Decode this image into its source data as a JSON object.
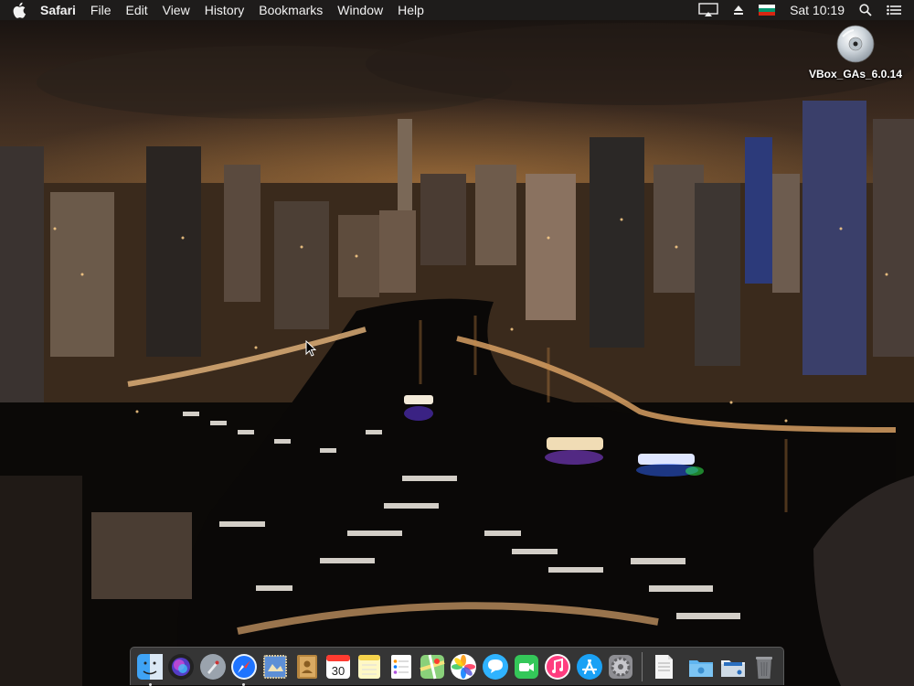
{
  "menubar": {
    "app_name": "Safari",
    "menus": [
      "File",
      "Edit",
      "View",
      "History",
      "Bookmarks",
      "Window",
      "Help"
    ],
    "clock": "Sat 10:19",
    "status_icons": [
      "airplay-icon",
      "eject-icon",
      "flag-bulgaria-icon",
      "spotlight-icon",
      "notification-center-icon"
    ]
  },
  "desktop": {
    "volume_label": "VBox_GAs_6.0.14",
    "volume_icon": "optical-disc-icon"
  },
  "dock": {
    "calendar_day": "30",
    "apps": [
      "Finder",
      "Siri",
      "Launchpad",
      "Safari",
      "Mail",
      "Contacts",
      "Calendar",
      "Notes",
      "Reminders",
      "Maps",
      "Photos",
      "Messages",
      "FaceTime",
      "iTunes",
      "App Store",
      "System Preferences",
      "TextEdit",
      "Downloads",
      "Screenshots",
      "Trash"
    ],
    "running": [
      "Finder",
      "Safari"
    ]
  },
  "colors": {
    "menubar_bg": "#1e1c1b",
    "dock_bg": "#464648",
    "accent_blue": "#1e74ff"
  }
}
